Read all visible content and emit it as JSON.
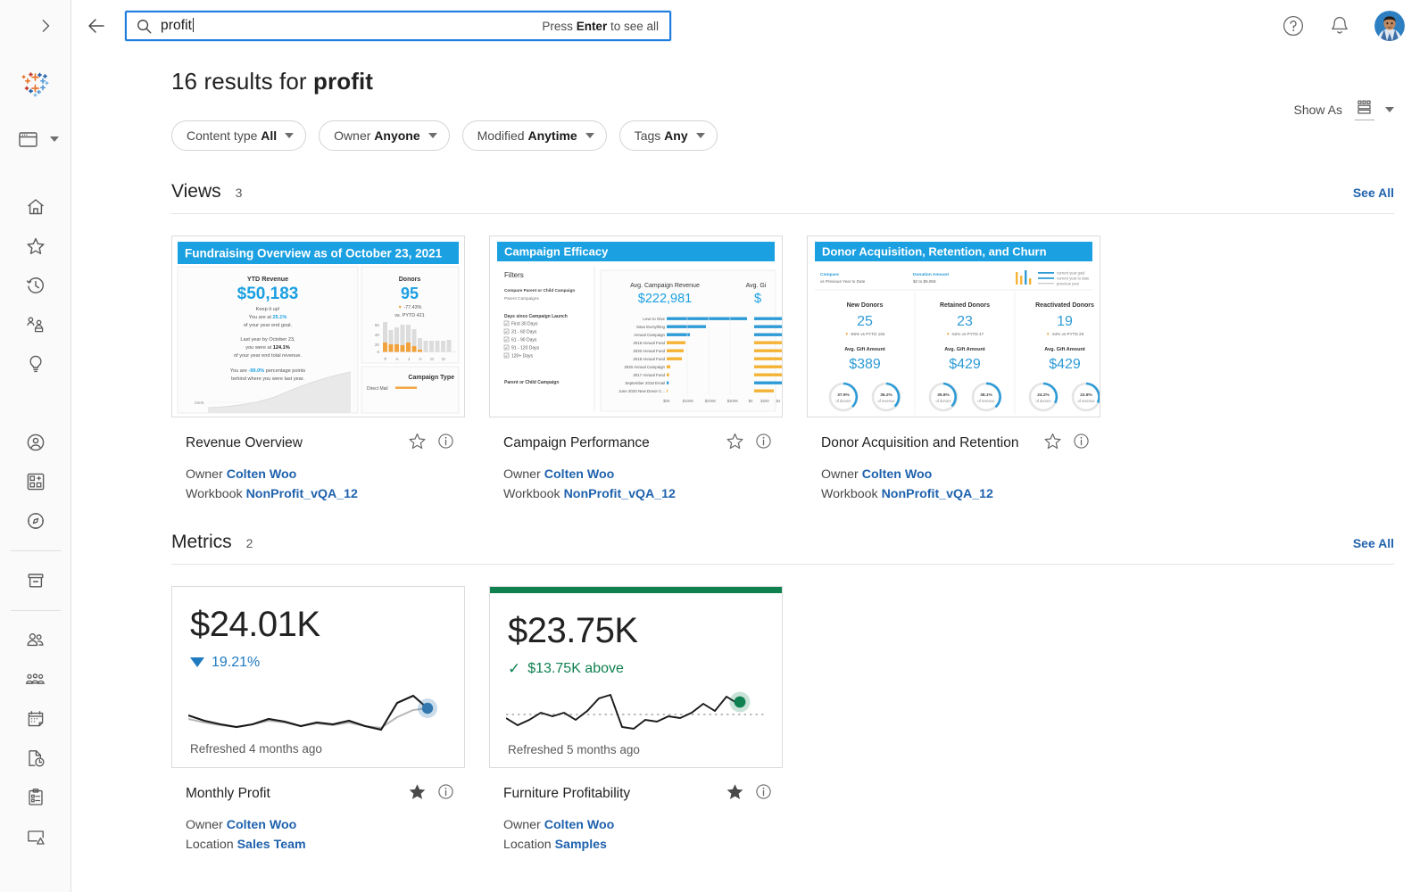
{
  "sidebar": {
    "expand_label": "expand-rail",
    "items": [
      {
        "name": "tableau-logo-icon",
        "label": "Tableau"
      },
      {
        "name": "explore-projects-icon",
        "label": "Explore"
      },
      {
        "name": "home-icon",
        "label": "Home"
      },
      {
        "name": "favorites-star-icon",
        "label": "Favorites"
      },
      {
        "name": "recents-clock-icon",
        "label": "Recents"
      },
      {
        "name": "shared-with-me-icon",
        "label": "Shared with Me"
      },
      {
        "name": "recommendations-bulb-icon",
        "label": "Recommendations"
      },
      {
        "name": "personal-space-icon",
        "label": "Personal Space"
      },
      {
        "name": "collections-icon",
        "label": "Collections"
      },
      {
        "name": "explore-compass-icon",
        "label": "Explore"
      },
      {
        "name": "external-assets-icon",
        "label": "External Assets"
      },
      {
        "name": "users-icon",
        "label": "Users"
      },
      {
        "name": "groups-icon",
        "label": "Groups"
      },
      {
        "name": "schedules-icon",
        "label": "Schedules"
      },
      {
        "name": "tasks-icon",
        "label": "Tasks"
      },
      {
        "name": "jobs-clipboard-icon",
        "label": "Jobs"
      },
      {
        "name": "extensions-icon",
        "label": "Extensions"
      }
    ]
  },
  "topbar": {
    "back_icon": "back-arrow-icon",
    "search": {
      "value": "profit",
      "placeholder": "Search",
      "icon": "search-icon",
      "hint_prefix": "Press ",
      "hint_key": "Enter",
      "hint_suffix": " to see all"
    },
    "help_icon": "help-question-icon",
    "notifications_icon": "notifications-bell-icon",
    "avatar": "user-avatar"
  },
  "results": {
    "prefix": "16 results for ",
    "query": "profit"
  },
  "filters": [
    {
      "label": "Content type ",
      "value": "All",
      "name": "filter-content-type"
    },
    {
      "label": "Owner ",
      "value": "Anyone",
      "name": "filter-owner"
    },
    {
      "label": "Modified ",
      "value": "Anytime",
      "name": "filter-modified"
    },
    {
      "label": "Tags ",
      "value": "Any",
      "name": "filter-tags"
    }
  ],
  "show_as": {
    "label": "Show As",
    "icon": "grid-view-icon",
    "caret": "chevron-down-icon"
  },
  "sections": [
    {
      "title": "Views",
      "count": "3",
      "see_all": "See All",
      "cards": [
        {
          "title": "Revenue Overview",
          "owner_label": "Owner",
          "owner": "Colten Woo",
          "secondary_label": "Workbook",
          "secondary": "NonProfit_vQA_12",
          "favorite": "unfilled",
          "thumb": {
            "banner": "Fundraising Overview as of October 23, 2021",
            "kpi_label": "YTD Revenue",
            "kpi_value": "$50,183",
            "body_lines": [
              "Keep it up!",
              "You are at  25.1%",
              "of your year end goal.",
              "Last year by October 23,",
              "you were at 124.1%",
              "of your year end total revenue.",
              "You are -99.0% percentage points",
              "behind where you were last year."
            ],
            "right_label": "Donors",
            "right_value": "95",
            "right_delta": "-77.43%",
            "right_sub": "vs. PYTD 421",
            "axis_ticks": [
              "60",
              "40",
              "20",
              "0"
            ],
            "axis_months": [
              "F",
              "A",
              "J",
              "A",
              "O",
              "D"
            ],
            "bottom_label": "Campaign Type",
            "legend": "Direct Mail",
            "y_axis_note": "250K"
          }
        },
        {
          "title": "Campaign Performance",
          "owner_label": "Owner",
          "owner": "Colten Woo",
          "secondary_label": "Workbook",
          "secondary": "NonProfit_vQA_12",
          "favorite": "unfilled",
          "thumb": {
            "banner": "Campaign Efficacy",
            "filters_title": "Filters",
            "filter_head": "Compare Parent or Child Campaign",
            "filter_sub": "Parent Campaigns",
            "days_title": "Days since Campaign Launch",
            "days_options": [
              "First 30 Days",
              "31 - 60 Days",
              "61 - 90 Days",
              "91 - 120 Days",
              "120+ Days"
            ],
            "parent_or_child": "Parent or Child Campaign",
            "kpi1_label": "Avg. Campaign Revenue",
            "kpi1_value": "$222,981",
            "kpi2_label": "Avg. Gi",
            "kpi2_value": "$",
            "bar_labels": [
              "Love to Give",
              "Save Everything",
              "Annual Campaign",
              "2019 Annual Fund",
              "2020 Annual Fund",
              "2018 Annual Fund",
              "2020 Annual Campaign",
              "2017 Annual Fund",
              "September 2018 Email",
              "June 2020 New Donor C..."
            ],
            "axis1": [
              "$0K",
              "$100K",
              "$200K",
              "$300K"
            ],
            "axis2": [
              "$0",
              "$200",
              "$4"
            ]
          }
        },
        {
          "title": "Donor Acquisition and Retention",
          "owner_label": "Owner",
          "owner": "Colten Woo",
          "secondary_label": "Workbook",
          "secondary": "NonProfit_vQA_12",
          "favorite": "unfilled",
          "thumb": {
            "banner": "Donor Acquisition, Retention, and Churn",
            "compare_label": "Compare",
            "compare_value": "vs Previous Year to Date",
            "donation_label": "Donation Amount",
            "donation_value": "$2 to $9,958",
            "legend": [
              "current year goal",
              "current year to date",
              "previous year"
            ],
            "panels": [
              {
                "title": "New Donors",
                "value": "25",
                "delta": "-86% vs PYTD 184",
                "gift_label": "Avg. Gift Amount",
                "gift_value": "$389",
                "donuts": [
                  {
                    "pct": "37.9%",
                    "sub": "of donors"
                  },
                  {
                    "pct": "36.2%",
                    "sub": "of revenue"
                  }
                ]
              },
              {
                "title": "Retained Donors",
                "value": "23",
                "delta": "-52% vs PYTD 47",
                "gift_label": "Avg. Gift Amount",
                "gift_value": "$429",
                "donuts": [
                  {
                    "pct": "35.8%",
                    "sub": "of donors"
                  },
                  {
                    "pct": "38.1%",
                    "sub": "of revenue"
                  }
                ]
              },
              {
                "title": "Reactivated Donors",
                "value": "19",
                "delta": "-34% vs PYTD 29",
                "gift_label": "Avg. Gift Amount",
                "gift_value": "$429",
                "donuts": [
                  {
                    "pct": "24.2%",
                    "sub": "of donors"
                  },
                  {
                    "pct": "22.8%",
                    "sub": "of revenue"
                  }
                ]
              }
            ]
          }
        }
      ]
    }
  ],
  "metrics_section": {
    "title": "Metrics",
    "count": "2",
    "see_all": "See All",
    "cards": [
      {
        "title": "Monthly Profit",
        "owner_label": "Owner",
        "owner": "Colten Woo",
        "secondary_label": "Location",
        "secondary": "Sales Team",
        "favorite": "filled",
        "value": "$24.01K",
        "delta": "19.21%",
        "delta_direction": "down",
        "delta_color": "#1f7ac0",
        "refreshed": "Refreshed 4 months ago",
        "accent": "none",
        "dot_color": "#3179ae",
        "spark": [
          42,
          50,
          54,
          57,
          54,
          47,
          50,
          56,
          52,
          54,
          50,
          56,
          60,
          27,
          18,
          22
        ],
        "spark_secondary": [
          46,
          52,
          57,
          58,
          56,
          52,
          52,
          57,
          54,
          56,
          54,
          58,
          60,
          44,
          34,
          24
        ]
      },
      {
        "title": "Furniture Profitability",
        "owner_label": "Owner",
        "owner": "Colten Woo",
        "secondary_label": "Location",
        "secondary": "Samples",
        "favorite": "filled",
        "value": "$23.75K",
        "delta": "$13.75K above",
        "delta_direction": "up",
        "delta_color": "#0f8050",
        "refreshed": "Refreshed 5 months ago",
        "accent": "#0f8050",
        "dot_color": "#0f8050",
        "spark": [
          52,
          62,
          56,
          44,
          48,
          52,
          38,
          44,
          20,
          14,
          66,
          70,
          50,
          46,
          48,
          44,
          52,
          36,
          52,
          26,
          18
        ],
        "baseline": 45
      }
    ]
  },
  "colors": {
    "link": "#1f62ad",
    "accent_blue": "#1f7de0",
    "green": "#0f8050",
    "banner_blue": "#1ba0e1"
  },
  "chart_data": [
    {
      "type": "line",
      "title": "Monthly Profit",
      "series": [
        {
          "name": "current",
          "values": [
            42,
            50,
            54,
            57,
            54,
            47,
            50,
            56,
            52,
            54,
            50,
            56,
            60,
            27,
            18,
            22
          ]
        },
        {
          "name": "previous",
          "values": [
            46,
            52,
            57,
            58,
            56,
            52,
            52,
            57,
            54,
            56,
            54,
            58,
            60,
            44,
            34,
            24
          ]
        }
      ],
      "summary_value": "$24.01K",
      "change": "-19.21%",
      "grid": false,
      "legend": "none"
    },
    {
      "type": "line",
      "title": "Furniture Profitability",
      "series": [
        {
          "name": "current",
          "values": [
            52,
            62,
            56,
            44,
            48,
            52,
            38,
            44,
            20,
            14,
            66,
            70,
            50,
            46,
            48,
            44,
            52,
            36,
            52,
            26,
            18
          ]
        }
      ],
      "summary_value": "$23.75K",
      "change": "$13.75K above",
      "baseline": 45,
      "grid": false,
      "legend": "none"
    }
  ]
}
